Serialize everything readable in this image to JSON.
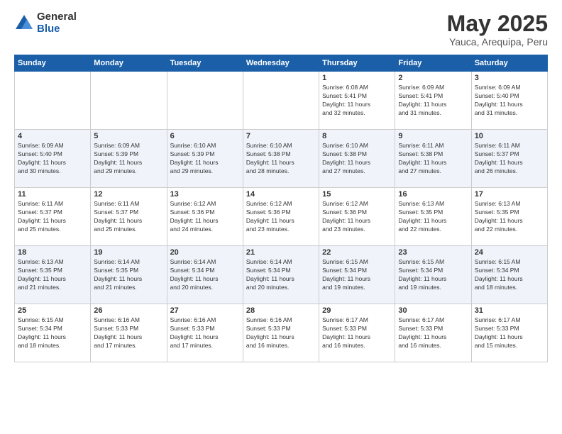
{
  "logo": {
    "general": "General",
    "blue": "Blue"
  },
  "header": {
    "title": "May 2025",
    "subtitle": "Yauca, Arequipa, Peru"
  },
  "weekdays": [
    "Sunday",
    "Monday",
    "Tuesday",
    "Wednesday",
    "Thursday",
    "Friday",
    "Saturday"
  ],
  "weeks": [
    [
      {
        "day": "",
        "info": ""
      },
      {
        "day": "",
        "info": ""
      },
      {
        "day": "",
        "info": ""
      },
      {
        "day": "",
        "info": ""
      },
      {
        "day": "1",
        "info": "Sunrise: 6:08 AM\nSunset: 5:41 PM\nDaylight: 11 hours\nand 32 minutes."
      },
      {
        "day": "2",
        "info": "Sunrise: 6:09 AM\nSunset: 5:41 PM\nDaylight: 11 hours\nand 31 minutes."
      },
      {
        "day": "3",
        "info": "Sunrise: 6:09 AM\nSunset: 5:40 PM\nDaylight: 11 hours\nand 31 minutes."
      }
    ],
    [
      {
        "day": "4",
        "info": "Sunrise: 6:09 AM\nSunset: 5:40 PM\nDaylight: 11 hours\nand 30 minutes."
      },
      {
        "day": "5",
        "info": "Sunrise: 6:09 AM\nSunset: 5:39 PM\nDaylight: 11 hours\nand 29 minutes."
      },
      {
        "day": "6",
        "info": "Sunrise: 6:10 AM\nSunset: 5:39 PM\nDaylight: 11 hours\nand 29 minutes."
      },
      {
        "day": "7",
        "info": "Sunrise: 6:10 AM\nSunset: 5:38 PM\nDaylight: 11 hours\nand 28 minutes."
      },
      {
        "day": "8",
        "info": "Sunrise: 6:10 AM\nSunset: 5:38 PM\nDaylight: 11 hours\nand 27 minutes."
      },
      {
        "day": "9",
        "info": "Sunrise: 6:11 AM\nSunset: 5:38 PM\nDaylight: 11 hours\nand 27 minutes."
      },
      {
        "day": "10",
        "info": "Sunrise: 6:11 AM\nSunset: 5:37 PM\nDaylight: 11 hours\nand 26 minutes."
      }
    ],
    [
      {
        "day": "11",
        "info": "Sunrise: 6:11 AM\nSunset: 5:37 PM\nDaylight: 11 hours\nand 25 minutes."
      },
      {
        "day": "12",
        "info": "Sunrise: 6:11 AM\nSunset: 5:37 PM\nDaylight: 11 hours\nand 25 minutes."
      },
      {
        "day": "13",
        "info": "Sunrise: 6:12 AM\nSunset: 5:36 PM\nDaylight: 11 hours\nand 24 minutes."
      },
      {
        "day": "14",
        "info": "Sunrise: 6:12 AM\nSunset: 5:36 PM\nDaylight: 11 hours\nand 23 minutes."
      },
      {
        "day": "15",
        "info": "Sunrise: 6:12 AM\nSunset: 5:36 PM\nDaylight: 11 hours\nand 23 minutes."
      },
      {
        "day": "16",
        "info": "Sunrise: 6:13 AM\nSunset: 5:35 PM\nDaylight: 11 hours\nand 22 minutes."
      },
      {
        "day": "17",
        "info": "Sunrise: 6:13 AM\nSunset: 5:35 PM\nDaylight: 11 hours\nand 22 minutes."
      }
    ],
    [
      {
        "day": "18",
        "info": "Sunrise: 6:13 AM\nSunset: 5:35 PM\nDaylight: 11 hours\nand 21 minutes."
      },
      {
        "day": "19",
        "info": "Sunrise: 6:14 AM\nSunset: 5:35 PM\nDaylight: 11 hours\nand 21 minutes."
      },
      {
        "day": "20",
        "info": "Sunrise: 6:14 AM\nSunset: 5:34 PM\nDaylight: 11 hours\nand 20 minutes."
      },
      {
        "day": "21",
        "info": "Sunrise: 6:14 AM\nSunset: 5:34 PM\nDaylight: 11 hours\nand 20 minutes."
      },
      {
        "day": "22",
        "info": "Sunrise: 6:15 AM\nSunset: 5:34 PM\nDaylight: 11 hours\nand 19 minutes."
      },
      {
        "day": "23",
        "info": "Sunrise: 6:15 AM\nSunset: 5:34 PM\nDaylight: 11 hours\nand 19 minutes."
      },
      {
        "day": "24",
        "info": "Sunrise: 6:15 AM\nSunset: 5:34 PM\nDaylight: 11 hours\nand 18 minutes."
      }
    ],
    [
      {
        "day": "25",
        "info": "Sunrise: 6:15 AM\nSunset: 5:34 PM\nDaylight: 11 hours\nand 18 minutes."
      },
      {
        "day": "26",
        "info": "Sunrise: 6:16 AM\nSunset: 5:33 PM\nDaylight: 11 hours\nand 17 minutes."
      },
      {
        "day": "27",
        "info": "Sunrise: 6:16 AM\nSunset: 5:33 PM\nDaylight: 11 hours\nand 17 minutes."
      },
      {
        "day": "28",
        "info": "Sunrise: 6:16 AM\nSunset: 5:33 PM\nDaylight: 11 hours\nand 16 minutes."
      },
      {
        "day": "29",
        "info": "Sunrise: 6:17 AM\nSunset: 5:33 PM\nDaylight: 11 hours\nand 16 minutes."
      },
      {
        "day": "30",
        "info": "Sunrise: 6:17 AM\nSunset: 5:33 PM\nDaylight: 11 hours\nand 16 minutes."
      },
      {
        "day": "31",
        "info": "Sunrise: 6:17 AM\nSunset: 5:33 PM\nDaylight: 11 hours\nand 15 minutes."
      }
    ]
  ]
}
